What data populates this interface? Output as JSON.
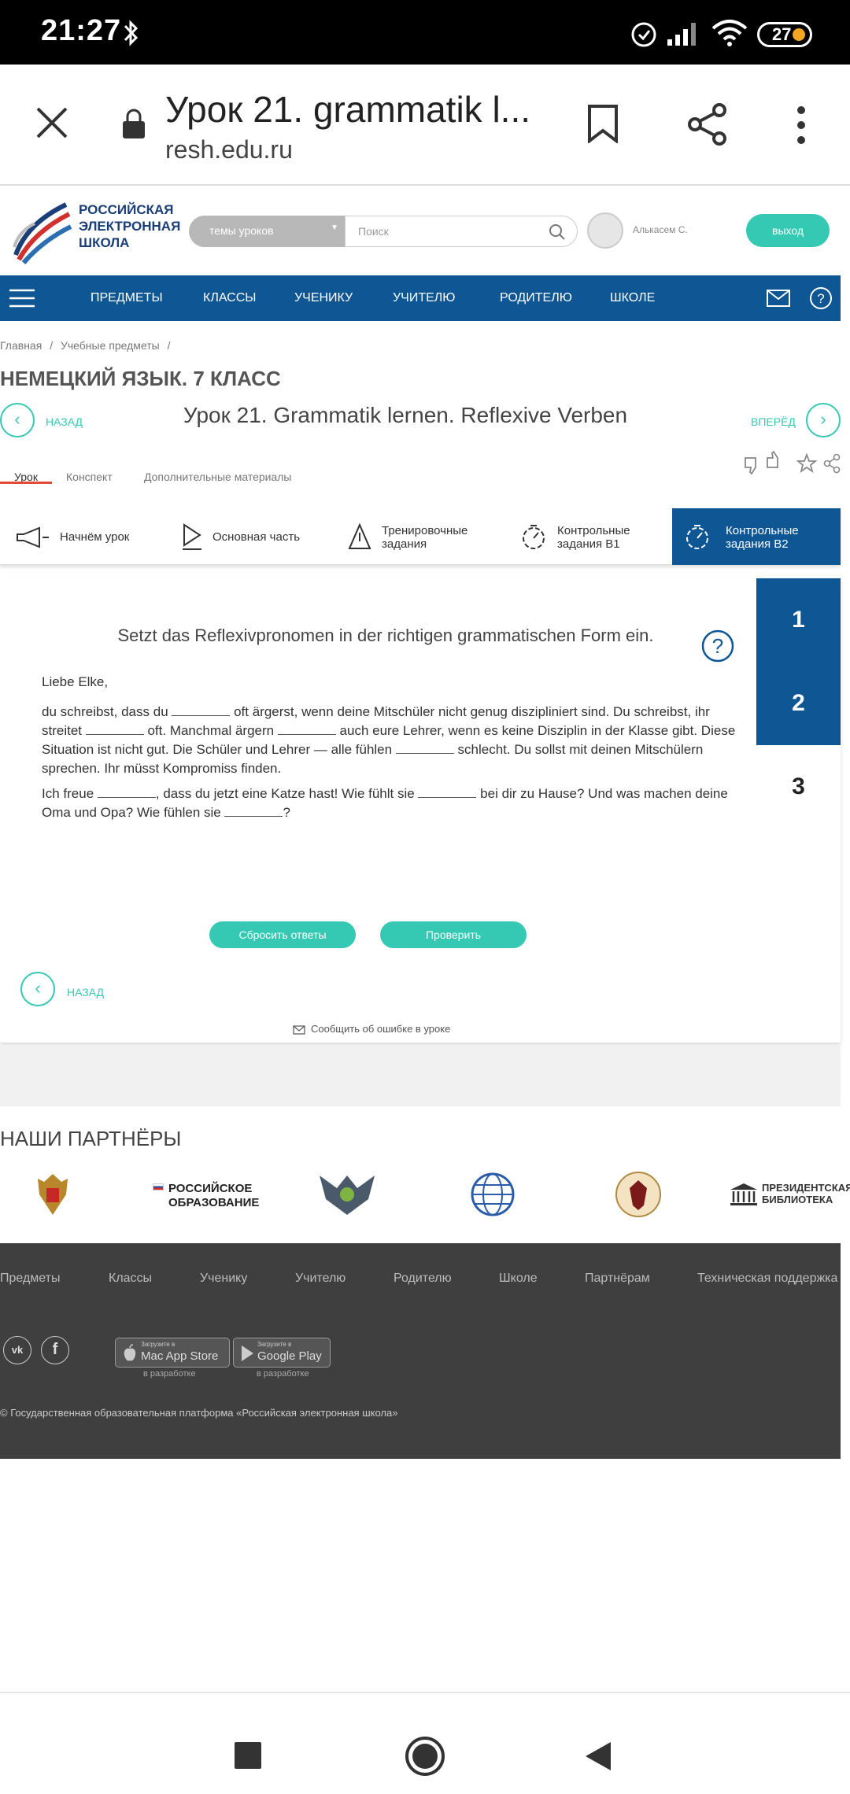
{
  "status_bar": {
    "time": "21:27",
    "battery": "27"
  },
  "browser": {
    "page_title": "Урок 21. grammatik l...",
    "domain": "resh.edu.ru"
  },
  "site_header": {
    "logo_lines": [
      "РОССИЙСКАЯ",
      "ЭЛЕКТРОННАЯ",
      "ШКОЛА"
    ],
    "theme_select": "темы уроков",
    "search_placeholder": "Поиск",
    "user_name": "Алькасем С.",
    "logout": "выход"
  },
  "nav": {
    "items": [
      "ПРЕДМЕТЫ",
      "КЛАССЫ",
      "УЧЕНИКУ",
      "УЧИТЕЛЮ",
      "РОДИТЕЛЮ",
      "ШКОЛЕ"
    ]
  },
  "breadcrumb": {
    "items": [
      "Главная",
      "Учебные предметы"
    ]
  },
  "subject_title": "НЕМЕЦКИЙ ЯЗЫК. 7 КЛАСС",
  "lesson": {
    "back": "НАЗАД",
    "forward": "ВПЕРЁД",
    "title": "Урок 21. Grammatik lernen. Reflexive Verben",
    "tabs": [
      "Урок",
      "Конспект",
      "Дополнительные материалы"
    ]
  },
  "steps": [
    "Начнём урок",
    "Основная часть",
    "Тренировочные задания",
    "Контрольные задания В1",
    "Контрольные задания В2"
  ],
  "task": {
    "numbers": [
      "1",
      "2",
      "3"
    ],
    "instruction": "Setzt das Reflexivpronomen in der richtigen grammatischen Form ein.",
    "greeting": "Liebe Elke,",
    "p1": [
      "du schreibst, dass du ",
      " oft ärgerst, wenn deine Mitschüler nicht genug diszipliniert sind. Du schreibst, ihr streitet ",
      " oft. Manchmal ärgern ",
      " auch eure Lehrer, wenn es keine Disziplin in der Klasse gibt. Diese Situation ist nicht gut. Die Schüler und Lehrer — alle fühlen ",
      " schlecht. Du sollst mit deinen Mitschülern sprechen. Ihr müsst Kompromiss finden."
    ],
    "p2": [
      "Ich freue ",
      ", dass du jetzt eine Katze hast! Wie fühlt sie ",
      " bei dir zu Hause? Und was machen deine Oma und Opa? Wie fühlen sie ",
      "?"
    ],
    "reset": "Сбросить ответы",
    "check": "Проверить",
    "back": "НАЗАД",
    "report": "Сообщить об ошибке в уроке"
  },
  "partners": {
    "title": "НАШИ ПАРТНЁРЫ",
    "ro_line1": "РОССИЙСКОЕ",
    "ro_line2": "ОБРАЗОВАНИЕ",
    "lib_line1": "ПРЕЗИДЕНТСКАЯ",
    "lib_line2": "БИБЛИОТЕКА"
  },
  "footer": {
    "links": [
      "Предметы",
      "Классы",
      "Ученику",
      "Учителю",
      "Родителю",
      "Школе",
      "Партнёрам",
      "Техническая поддержка"
    ],
    "appstore_small": "Загрузите в",
    "appstore": "Mac App Store",
    "googleplay_small": "Загрузите в",
    "googleplay": "Google Play",
    "in_dev": "в разработке",
    "copyright": "© Государственная образовательная платформа «Российская электронная школа»"
  },
  "colors": {
    "accent": "#35c9b3",
    "nav_blue": "#0f5694",
    "footer_bg": "#3f3f3f"
  }
}
